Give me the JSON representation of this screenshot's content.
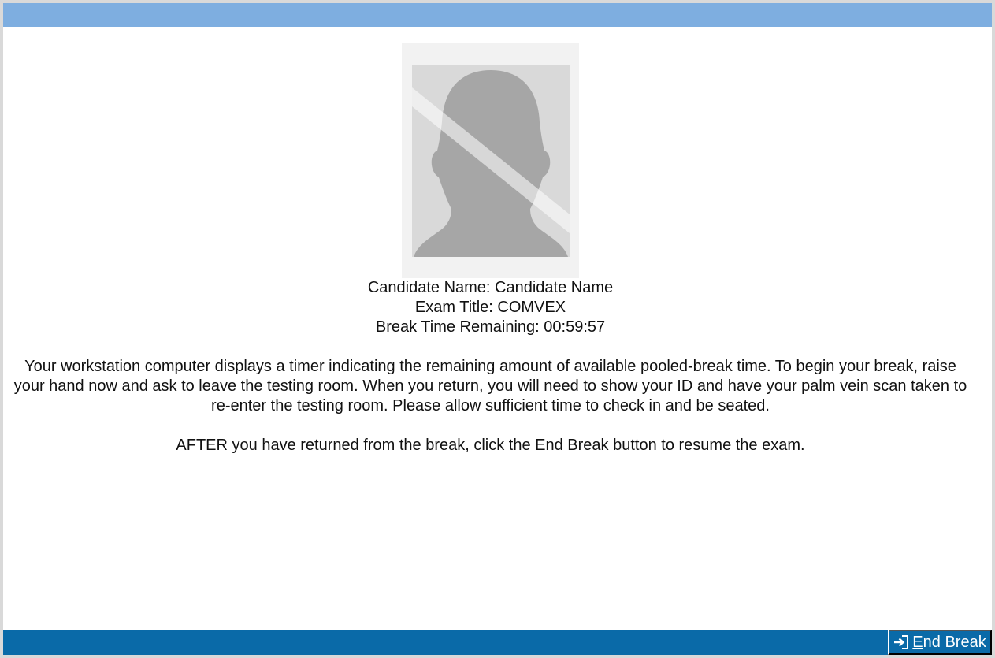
{
  "header": {
    "bar_color": "#7eaee0"
  },
  "photo": {
    "icon": "no-photo-placeholder-icon"
  },
  "candidate": {
    "name_line": "Candidate Name: Candidate Name",
    "exam_line": "Exam Title: COMVEX",
    "time_line": "Break Time Remaining: 00:59:57"
  },
  "instructions": {
    "paragraph": "Your workstation computer displays a timer indicating the remaining amount of available pooled-break time. To begin your break, raise your hand now and ask to leave the testing room. When you return, you will need to show your ID and have your palm vein scan taken to re-enter the testing room. Please allow sufficient time to check in and be seated.",
    "after": "AFTER you have returned from the break, click the End Break button to resume the exam."
  },
  "footer": {
    "bar_color": "#0a6aa8",
    "end_break": {
      "label_first": "E",
      "label_rest": "nd Break",
      "icon": "sign-in-icon"
    }
  }
}
